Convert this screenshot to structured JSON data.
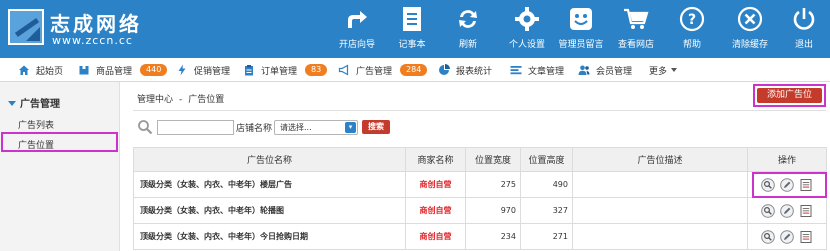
{
  "brand": {
    "title": "志成网络",
    "url": "www.zccn.cc"
  },
  "top_nav": [
    {
      "label": "开店向导",
      "icon": "share-arrow-icon"
    },
    {
      "label": "记事本",
      "icon": "notepad-icon"
    },
    {
      "label": "刷新",
      "icon": "refresh-icon"
    },
    {
      "label": "个人设置",
      "icon": "gear-icon"
    },
    {
      "label": "管理员留言",
      "icon": "smile-message-icon"
    },
    {
      "label": "查看网店",
      "icon": "cart-icon"
    },
    {
      "label": "帮助",
      "icon": "help-icon"
    },
    {
      "label": "清除缓存",
      "icon": "close-circle-icon"
    },
    {
      "label": "退出",
      "icon": "power-icon"
    }
  ],
  "sub_nav": [
    {
      "label": "起始页",
      "icon": "home-icon"
    },
    {
      "label": "商品管理",
      "icon": "box-icon",
      "badge": "440"
    },
    {
      "label": "促销管理",
      "icon": "lightning-icon"
    },
    {
      "label": "订单管理",
      "icon": "clipboard-icon",
      "badge": "83"
    },
    {
      "label": "广告管理",
      "icon": "megaphone-icon",
      "badge": "284"
    },
    {
      "label": "报表统计",
      "icon": "piechart-icon"
    },
    {
      "label": "文章管理",
      "icon": "list-icon"
    },
    {
      "label": "会员管理",
      "icon": "users-icon"
    },
    {
      "label": "更多",
      "icon": "chevron-down-icon"
    }
  ],
  "sidebar": {
    "title": "广告管理",
    "items": [
      {
        "label": "广告列表"
      },
      {
        "label": "广告位置"
      }
    ]
  },
  "breadcrumb": {
    "root": "管理中心",
    "separator": "-",
    "current": "广告位置"
  },
  "add_button": "添加广告位",
  "search": {
    "input_value": "",
    "store_label": "店铺名称",
    "select_value": "请选择...",
    "button": "搜索"
  },
  "table": {
    "headers": [
      "广告位名称",
      "商家名称",
      "位置宽度",
      "位置高度",
      "广告位描述",
      "操作"
    ],
    "rows": [
      {
        "name": "顶级分类（女装、内衣、中老年）楼层广告",
        "merchant": "商创自营",
        "width": "275",
        "height": "490",
        "desc": ""
      },
      {
        "name": "顶级分类（女装、内衣、中老年）轮播图",
        "merchant": "商创自营",
        "width": "970",
        "height": "327",
        "desc": ""
      },
      {
        "name": "顶级分类（女装、内衣、中老年）今日抢购日期",
        "merchant": "商创自营",
        "width": "234",
        "height": "271",
        "desc": ""
      }
    ],
    "operations": [
      "view-icon",
      "edit-icon",
      "list-icon"
    ]
  },
  "colors": {
    "header_bg": "#2b82c7",
    "badge": "#f07d1e",
    "primary_button": "#c43b2c",
    "merchant_text": "#e0262a",
    "highlight_outline": "#cc33cc"
  }
}
